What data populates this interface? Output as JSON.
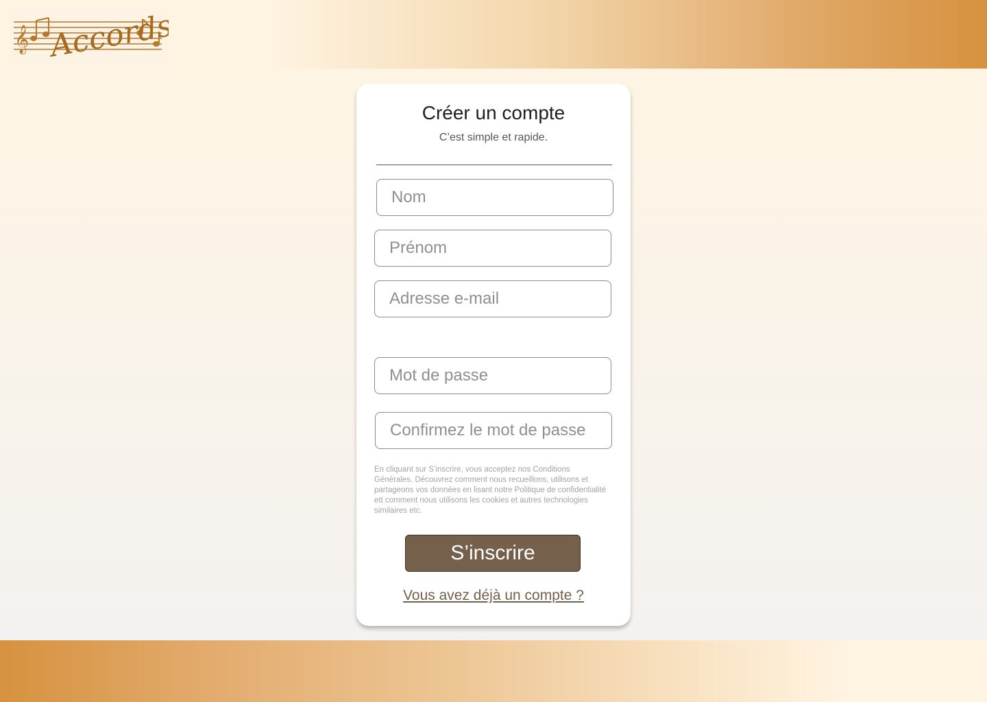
{
  "logo": {
    "text": "Accords",
    "icon": "music-staff-logo-icon"
  },
  "form": {
    "title": "Créer un compte",
    "subtitle": "C’est simple et rapide.",
    "fields": {
      "nom": {
        "placeholder": "Nom",
        "value": ""
      },
      "prenom": {
        "placeholder": "Prénom",
        "value": ""
      },
      "email": {
        "placeholder": "Adresse e-mail",
        "value": ""
      },
      "password": {
        "placeholder": "Mot de passe",
        "value": ""
      },
      "confirm": {
        "placeholder": "Confirmez le mot de passe",
        "value": ""
      }
    },
    "terms": "En cliquant sur S’inscrire, vous acceptez nos Conditions Générales. Découvrez comment nous recueillons, utilisons et partageons vos données en lisant notre Politique de confidentialité ett comment nous utilisons les cookies et autres technologies similaires etc.",
    "submit_label": "S’inscrire",
    "login_link": "Vous avez déjà un compte ?"
  },
  "colors": {
    "accent": "#d6923f",
    "button": "#74604b",
    "background": "#fff4e2"
  }
}
